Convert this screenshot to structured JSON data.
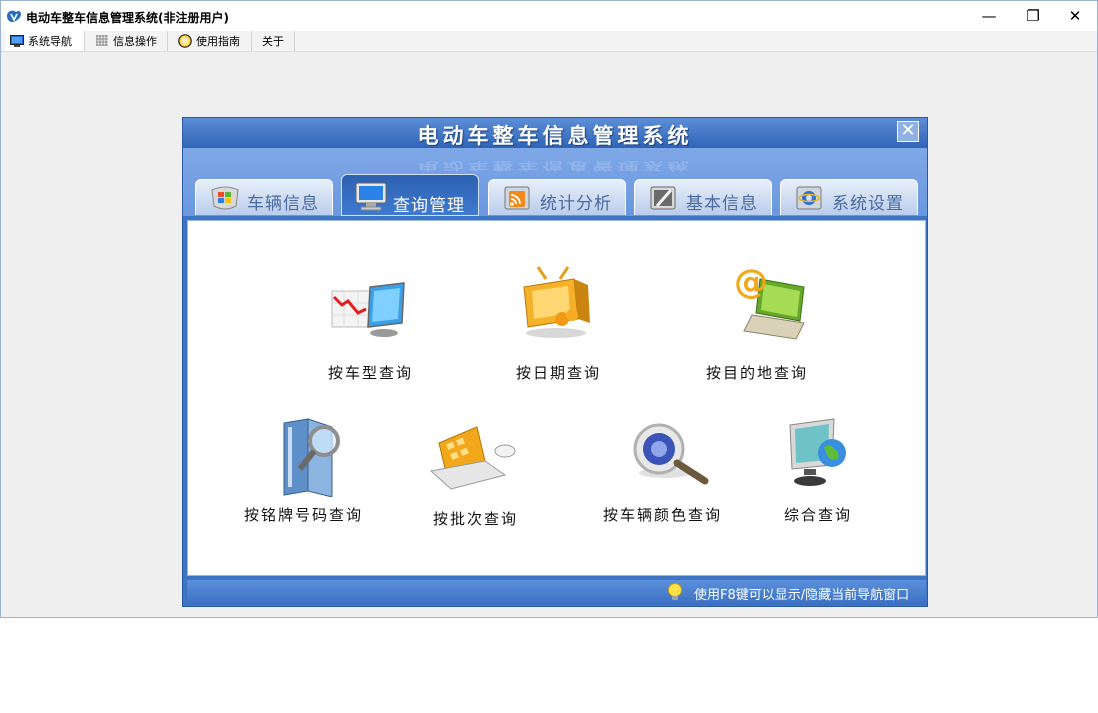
{
  "window": {
    "title": "电动车整车信息管理系统(非注册用户)",
    "minimize_glyph": "—",
    "maximize_glyph": "❐",
    "close_glyph": "✕"
  },
  "menu": {
    "items": [
      {
        "label": "系统导航",
        "icon": "monitor-icon",
        "active": true
      },
      {
        "label": "信息操作",
        "icon": "grid-icon",
        "active": false
      },
      {
        "label": "使用指南",
        "icon": "help-circle-icon",
        "active": false
      },
      {
        "label": "关于",
        "icon": "",
        "active": false
      }
    ]
  },
  "dialog": {
    "title": "电动车整车信息管理系统",
    "close_glyph": "✕",
    "tabs": [
      {
        "label": "车辆信息",
        "icon": "shield-windows-icon",
        "active": false
      },
      {
        "label": "查询管理",
        "icon": "monitor-icon",
        "active": true
      },
      {
        "label": "统计分析",
        "icon": "rss-feed-icon",
        "active": false
      },
      {
        "label": "基本信息",
        "icon": "notebook-pen-icon",
        "active": false
      },
      {
        "label": "系统设置",
        "icon": "ie-globe-icon",
        "active": false
      }
    ],
    "query_items": [
      {
        "label": "按车型查询",
        "icon": "chart-monitor-icon"
      },
      {
        "label": "按日期查询",
        "icon": "tv-icon"
      },
      {
        "label": "按目的地查询",
        "icon": "email-laptop-icon"
      },
      {
        "label": "按铭牌号码查询",
        "icon": "book-magnifier-icon"
      },
      {
        "label": "按批次查询",
        "icon": "laptop-mouse-icon"
      },
      {
        "label": "按车辆颜色查询",
        "icon": "search-magnifier-icon"
      },
      {
        "label": "综合查询",
        "icon": "globe-monitor-icon"
      }
    ],
    "status": {
      "text": "使用F8键可以显示/隐藏当前导航窗口",
      "icon": "lightbulb-icon"
    }
  },
  "colors": {
    "dialog_blue": "#3e74c4",
    "tab_band": "#7ea7e6",
    "status_bar": "#4a80d0",
    "active_tab": "#3670c2"
  }
}
